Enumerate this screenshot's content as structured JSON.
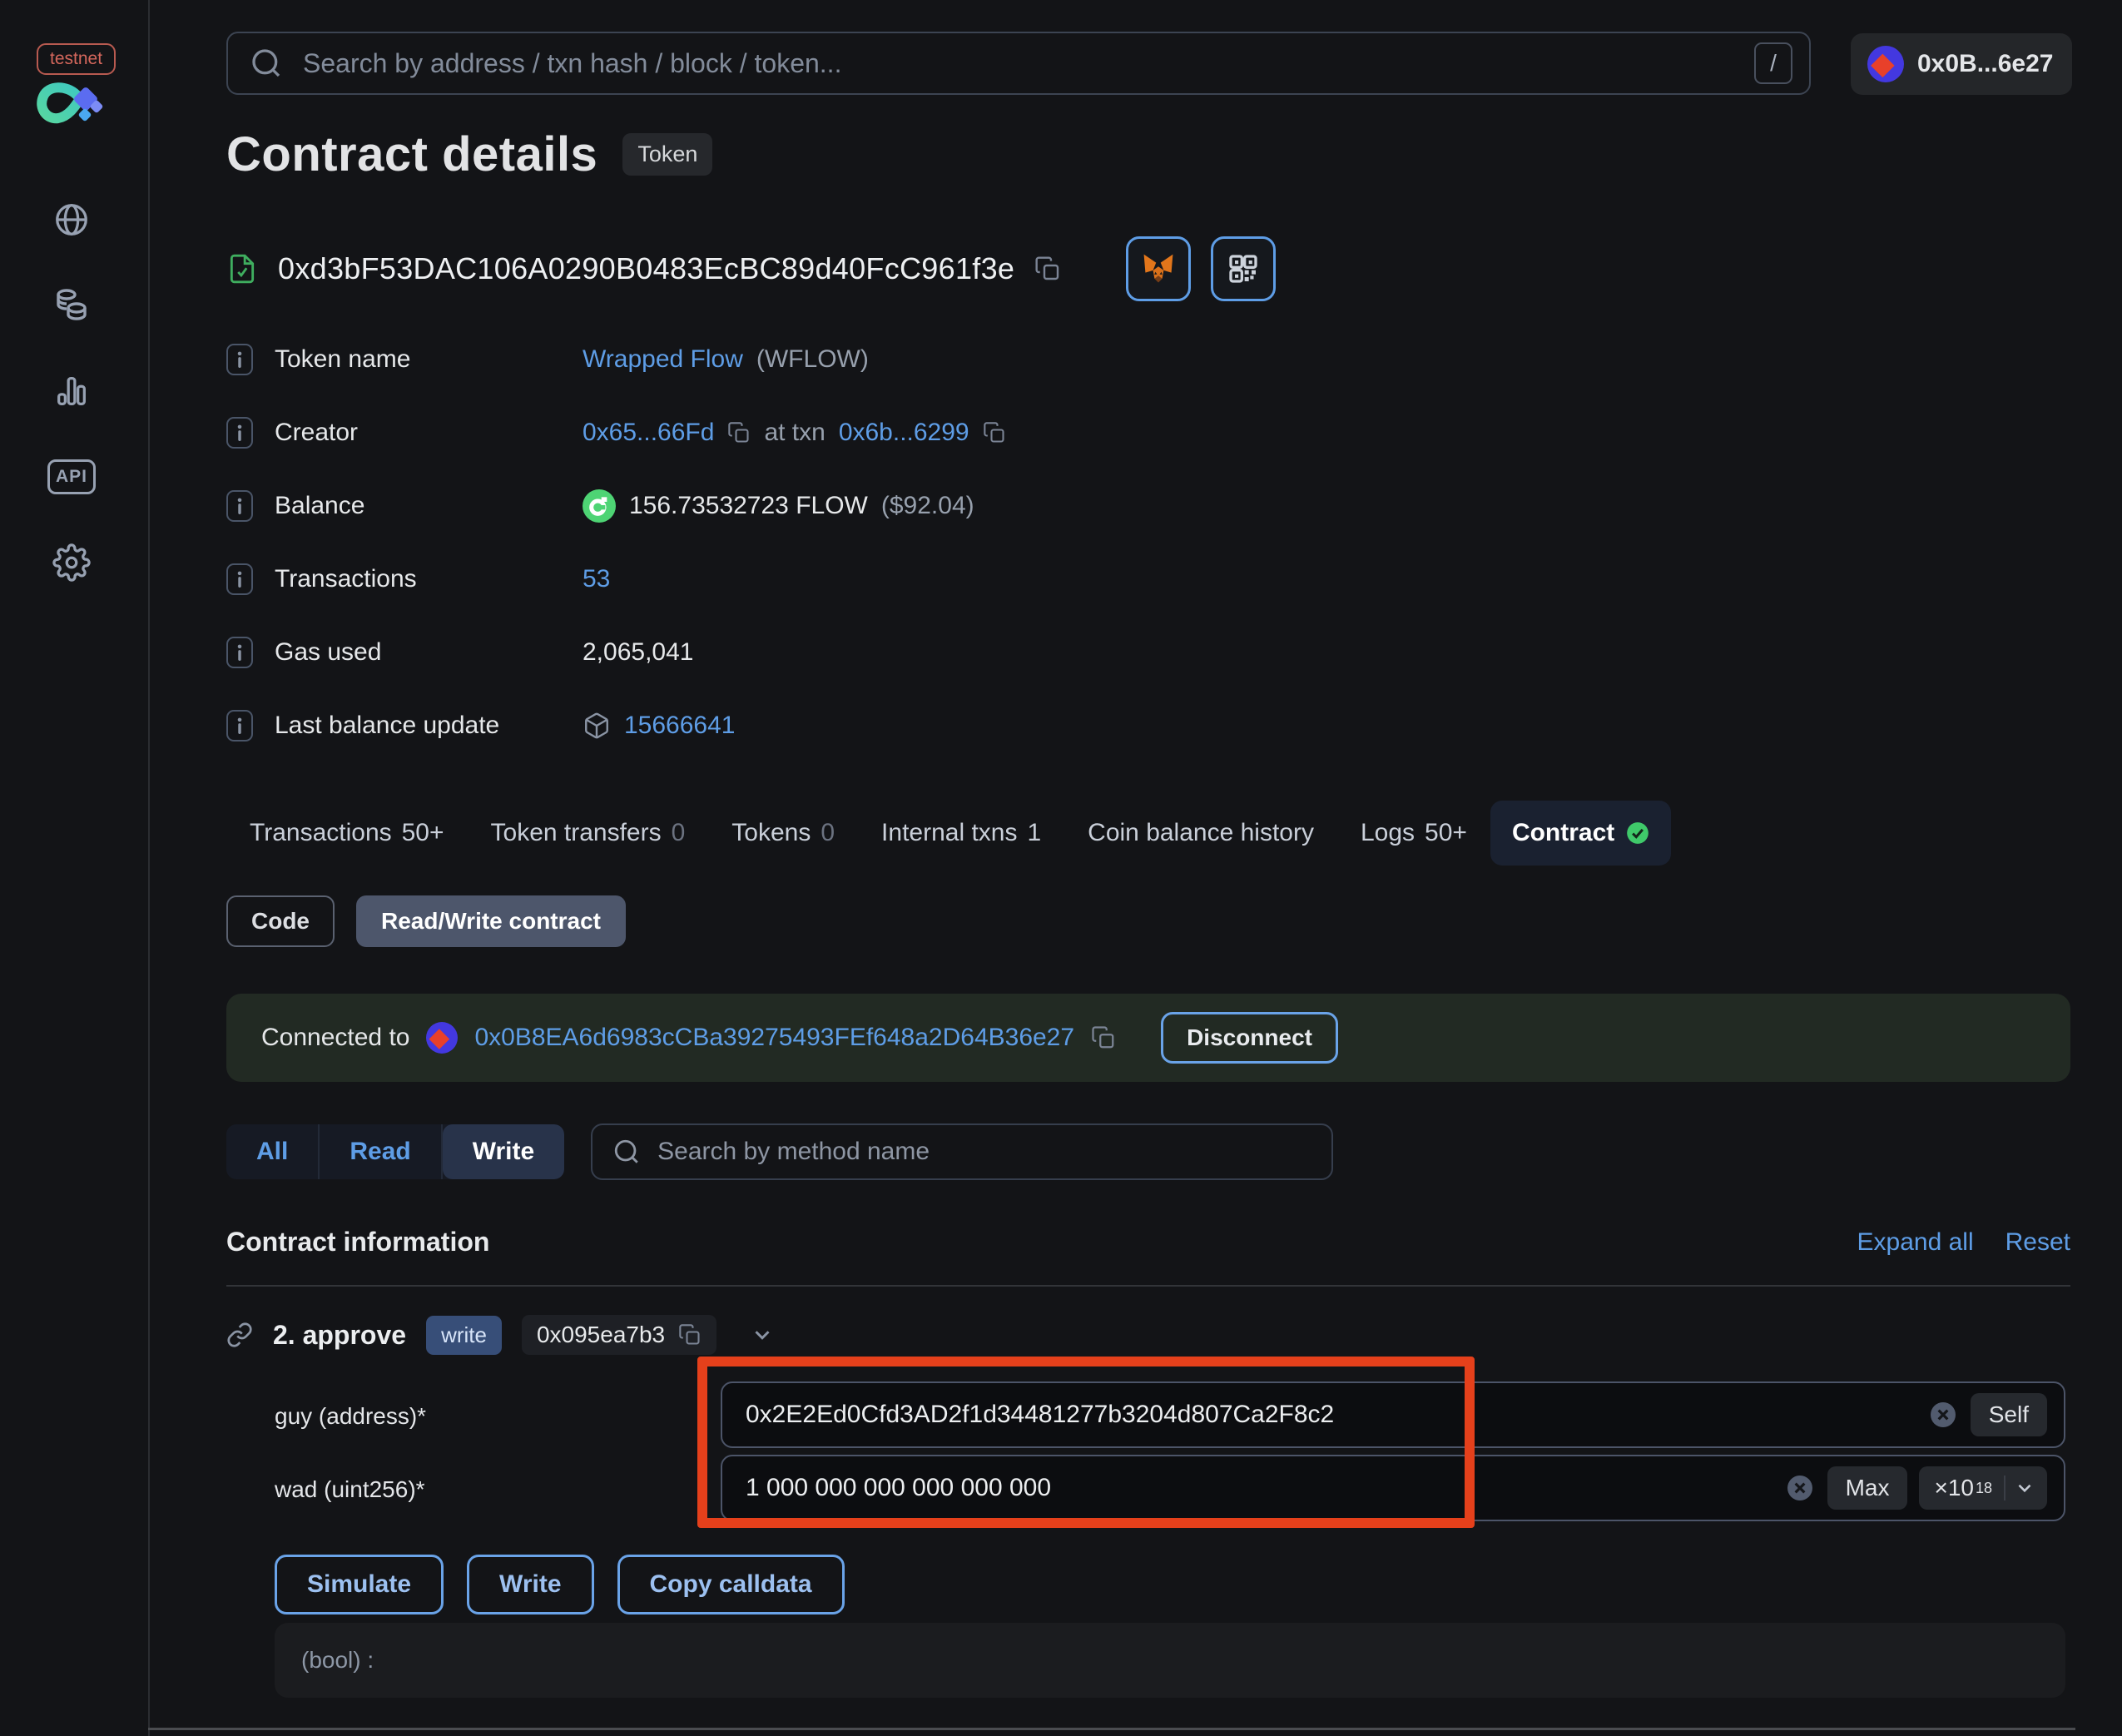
{
  "colors": {
    "background": "#131417",
    "link_accent": "#5e9de6",
    "annotation": "#e5401b",
    "success_green": "#3fc96a",
    "banner_green": "#222a23",
    "testnet_red": "#d4675c"
  },
  "sidebar": {
    "badge": "testnet",
    "api_label": "API"
  },
  "topbar": {
    "search_placeholder": "Search by address / txn hash / block / token...",
    "search_shortcut": "/",
    "account_label": "0x0B...6e27"
  },
  "header": {
    "title": "Contract details",
    "type_badge": "Token",
    "address": "0xd3bF53DAC106A0290B0483EcBC89d40FcC961f3e"
  },
  "info": {
    "token_name": {
      "label": "Token name",
      "link": "Wrapped Flow",
      "suffix": "(WFLOW)"
    },
    "creator": {
      "label": "Creator",
      "address": "0x65...66Fd",
      "middle": "at txn",
      "txn": "0x6b...6299"
    },
    "balance": {
      "label": "Balance",
      "amount": "156.73532723 FLOW",
      "usd": "($92.04)"
    },
    "transactions": {
      "label": "Transactions",
      "value": "53"
    },
    "gas_used": {
      "label": "Gas used",
      "value": "2,065,041"
    },
    "last_balance_update": {
      "label": "Last balance update",
      "value": "15666641"
    }
  },
  "tabs": {
    "items": [
      {
        "label": "Transactions",
        "count": "50+"
      },
      {
        "label": "Token transfers",
        "count": "0"
      },
      {
        "label": "Tokens",
        "count": "0"
      },
      {
        "label": "Internal txns",
        "count": "1"
      },
      {
        "label": "Coin balance history",
        "count": ""
      },
      {
        "label": "Logs",
        "count": "50+"
      },
      {
        "label": "Contract",
        "count": ""
      }
    ]
  },
  "subtabs": {
    "code": "Code",
    "read_write": "Read/Write contract"
  },
  "connection": {
    "prefix": "Connected to",
    "address": "0x0B8EA6d6983cCBa39275493FEf648a2D64B36e27",
    "disconnect": "Disconnect"
  },
  "filters": {
    "all": "All",
    "read": "Read",
    "write": "Write",
    "search_placeholder": "Search by method name"
  },
  "contract_info": {
    "title": "Contract information",
    "expand_all": "Expand all",
    "reset": "Reset"
  },
  "method": {
    "name": "2. approve",
    "badge": "write",
    "selector": "0x095ea7b3",
    "params": [
      {
        "label": "guy (address)*",
        "value": "0x2E2Ed0Cfd3AD2f1d34481277b3204d807Ca2F8c2",
        "action": "Self"
      },
      {
        "label": "wad (uint256)*",
        "value": "1 000 000 000 000 000 000",
        "action": "Max",
        "multiplier": "×10",
        "exponent": "18"
      }
    ],
    "actions": {
      "simulate": "Simulate",
      "write": "Write",
      "copy_calldata": "Copy calldata"
    },
    "output": "(bool) :"
  }
}
